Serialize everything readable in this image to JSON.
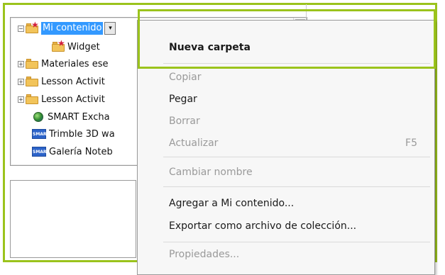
{
  "tree": {
    "items": [
      {
        "label": "Mi contenido",
        "icon": "starred-folder-icon",
        "selected": true
      },
      {
        "label": "Widget",
        "icon": "starred-folder-icon"
      },
      {
        "label": "Materiales ese",
        "icon": "folder-icon"
      },
      {
        "label": "Lesson Activit",
        "icon": "folder-icon"
      },
      {
        "label": "Lesson Activit",
        "icon": "folder-icon"
      },
      {
        "label": "SMART Excha",
        "icon": "globe-icon"
      },
      {
        "label": "Trimble 3D wa",
        "icon": "smart-badge-icon"
      },
      {
        "label": "Galería Noteb",
        "icon": "smart-badge-icon"
      }
    ],
    "expander_collapsed": "+",
    "expander_expanded": "−",
    "dropdown_glyph": "▾",
    "scroll_up_glyph": "▴",
    "star_glyph": "★",
    "badge_text": "SMART"
  },
  "context_menu": {
    "nueva_carpeta": "Nueva carpeta",
    "copiar": "Copiar",
    "pegar": "Pegar",
    "borrar": "Borrar",
    "actualizar": "Actualizar",
    "actualizar_shortcut": "F5",
    "cambiar_nombre": "Cambiar nombre",
    "agregar": "Agregar a Mi contenido...",
    "exportar": "Exportar como archivo de colección...",
    "propiedades": "Propiedades..."
  },
  "colors": {
    "highlight_green": "#9bc31c",
    "selection_blue": "#3399ff",
    "disabled_text": "#9a9a9a"
  }
}
